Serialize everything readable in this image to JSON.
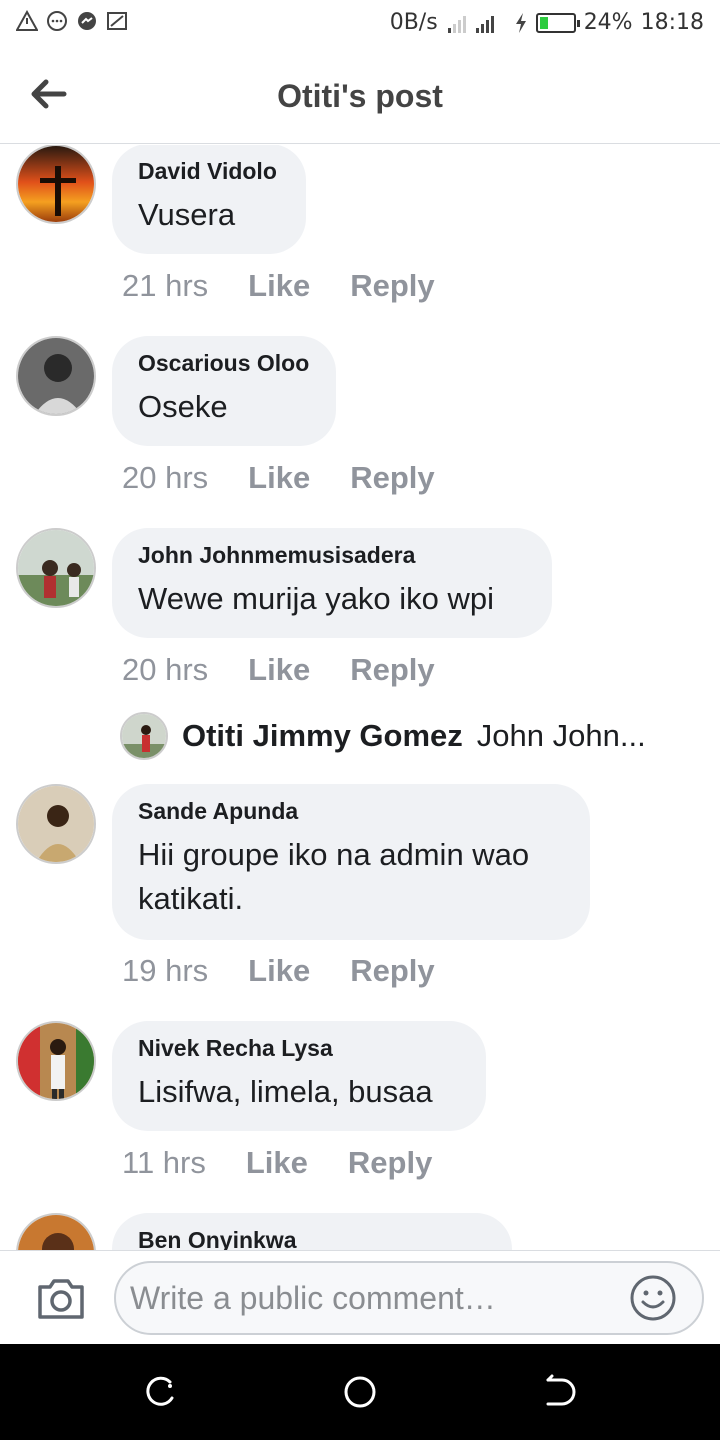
{
  "status_bar": {
    "speed": "0B/s",
    "battery": "24%",
    "time": "18:18",
    "battery_level": 0.24,
    "icons": [
      "warning-triangle-icon",
      "chat-icon",
      "messenger-icon",
      "screen-icon",
      "signal-icon",
      "charging-icon"
    ]
  },
  "header": {
    "title": "Otiti's post",
    "back_icon": "back-arrow-icon"
  },
  "comments": [
    {
      "author": "David Vidolo",
      "text": "Vusera",
      "time": "21 hrs",
      "like": "Like",
      "reply": "Reply"
    },
    {
      "author": "Oscarious Oloo",
      "text": "Oseke",
      "time": "20 hrs",
      "like": "Like",
      "reply": "Reply"
    },
    {
      "author": "John Johnmemusisadera",
      "text": "Wewe murija yako iko wpi",
      "time": "20 hrs",
      "like": "Like",
      "reply": "Reply"
    },
    {
      "author": "Sande Apunda",
      "text": "Hii groupe iko na admin wao katikati.",
      "time": "19 hrs",
      "like": "Like",
      "reply": "Reply"
    },
    {
      "author": "Nivek Recha Lysa",
      "text": "Lisifwa, limela, busaa",
      "time": "11 hrs",
      "like": "Like",
      "reply": "Reply"
    },
    {
      "author": "Ben Onyinkwa",
      "text": "",
      "time": "",
      "like": "",
      "reply": ""
    }
  ],
  "reply_preview": {
    "author": "Otiti Jimmy Gomez",
    "text": "John John..."
  },
  "composer": {
    "placeholder": "Write a public comment…",
    "camera_icon": "camera-icon",
    "emoji_icon": "emoji-icon"
  },
  "nav": {
    "icons": [
      "recents-icon",
      "home-icon",
      "back-icon"
    ]
  },
  "colors": {
    "bubble": "#f0f2f5",
    "meta": "#90949c",
    "battery": "#2ecc40"
  }
}
